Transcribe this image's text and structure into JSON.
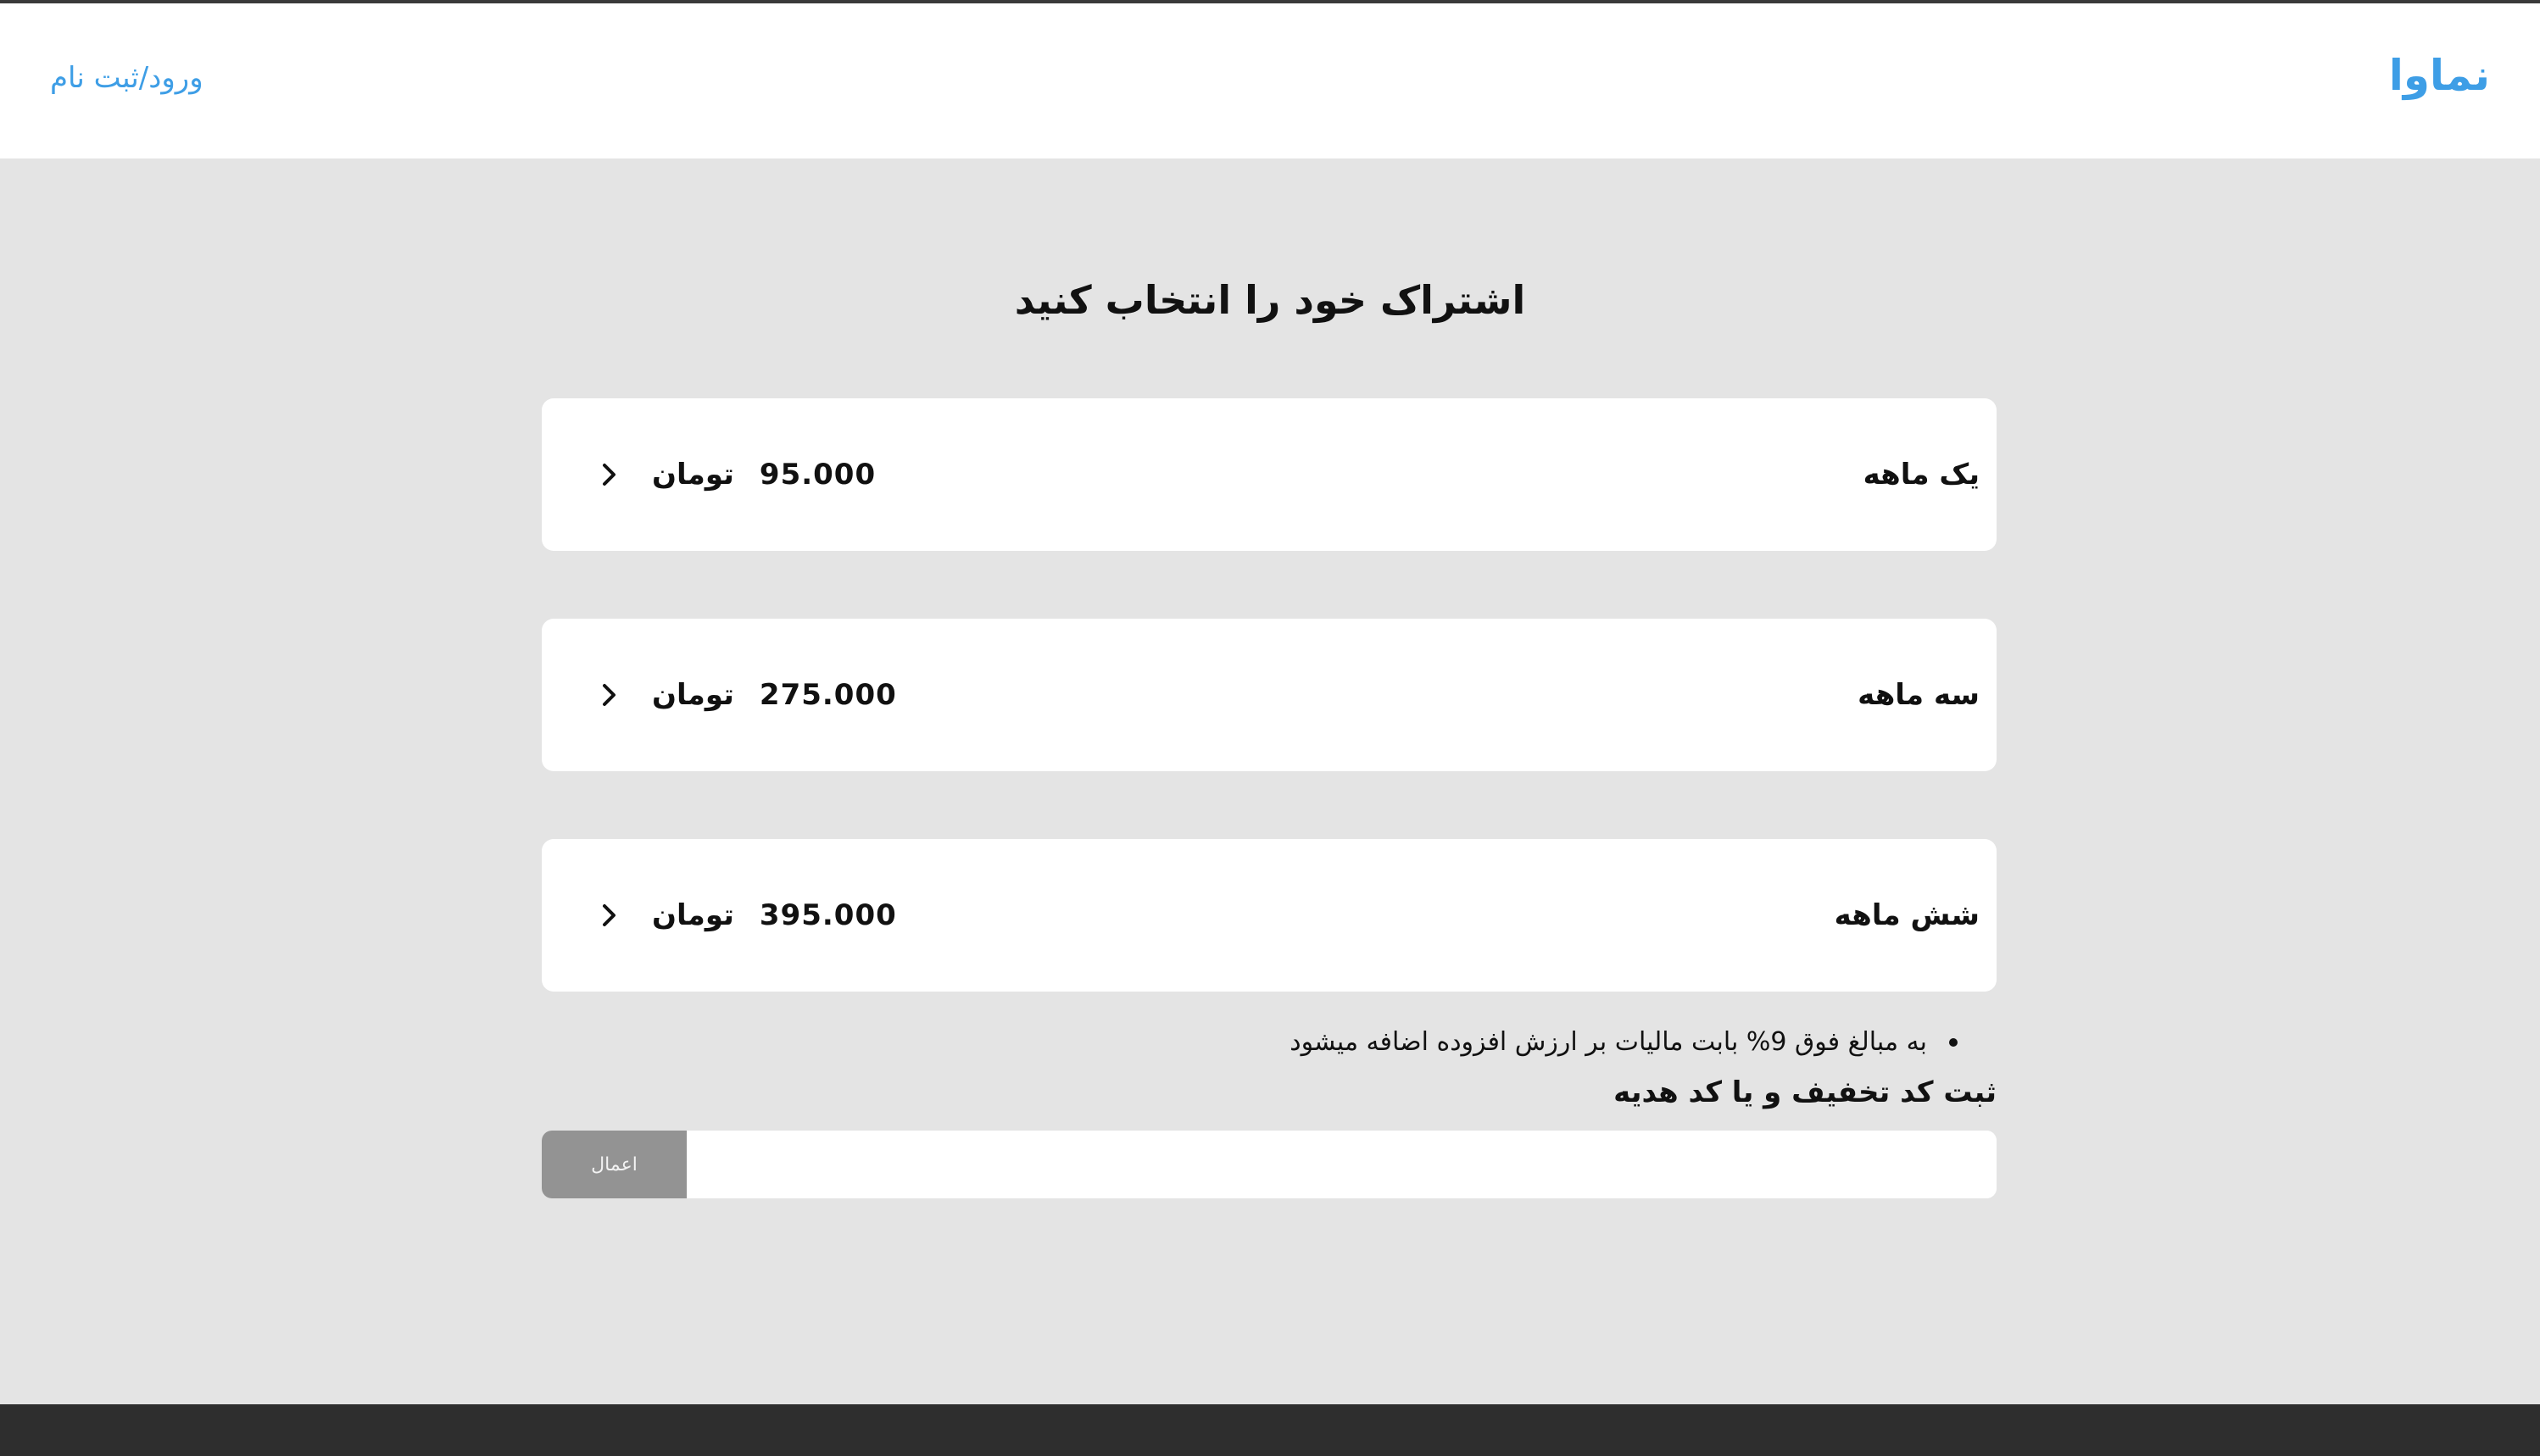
{
  "header": {
    "logo": "نماوا",
    "login_link": "ورود/ثبت نام"
  },
  "main": {
    "title": "اشتراک خود را انتخاب کنید",
    "plans": [
      {
        "name": "یک ماهه",
        "amount": "95.000",
        "currency": "تومان"
      },
      {
        "name": "سه ماهه",
        "amount": "275.000",
        "currency": "تومان"
      },
      {
        "name": "شش ماهه",
        "amount": "395.000",
        "currency": "تومان"
      }
    ],
    "tax_note": "به مبالغ فوق 9% بابت مالیات بر ارزش افزوده اضافه میشود",
    "discount_label": "ثبت کد تخفیف و یا کد هدیه",
    "discount_input_value": "",
    "apply_button": "اعمال"
  },
  "colors": {
    "brand": "#3e9ee6",
    "background": "#e4e4e4",
    "footer": "#2e2e2e",
    "button": "#939393"
  },
  "icons": {
    "plan_chevron": "chevron-right-icon"
  }
}
